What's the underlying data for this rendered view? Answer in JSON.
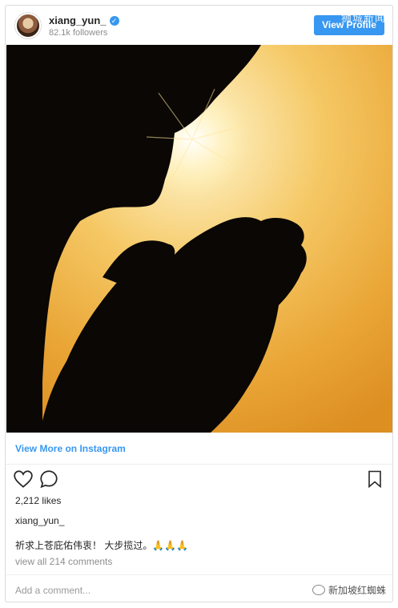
{
  "header": {
    "username": "xiang_yun_",
    "followers": "82.1k followers",
    "view_profile_label": "View Profile",
    "watermark": "狮城新闻"
  },
  "post": {
    "view_more_label": "View More on Instagram",
    "likes": "2,212 likes",
    "caption_user": "xiang_yun_",
    "caption_text": "祈求上苍庇佑伟衷！ 大步揽过。🙏🙏🙏",
    "view_comments": "view all 214 comments",
    "add_comment_placeholder": "Add a comment...",
    "footer_watermark": "新加坡红蜘蛛"
  },
  "colors": {
    "accent": "#3897f0",
    "sky_light": "#f8d98a",
    "sky_dark": "#e49a2a"
  },
  "icons": [
    "verified-badge",
    "heart-icon",
    "comment-icon",
    "bookmark-icon",
    "wechat-icon"
  ]
}
